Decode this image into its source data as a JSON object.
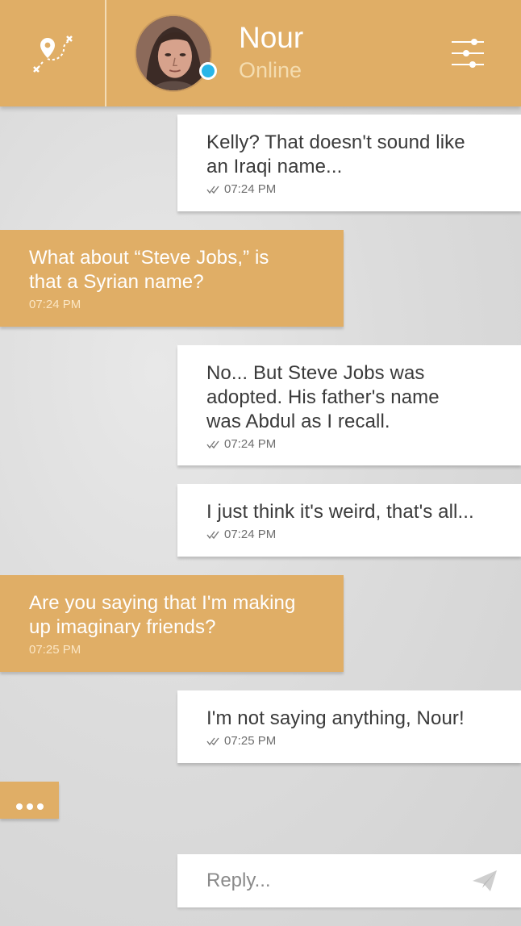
{
  "header": {
    "contact_name": "Nour",
    "contact_status": "Online",
    "status_color": "#29b6e8",
    "accent_color": "#e0ae66"
  },
  "messages": [
    {
      "direction": "outgoing",
      "text": "Kelly? That doesn't sound like\nan Iraqi name...",
      "time": "07:24 PM",
      "read_icon": "double-check-icon"
    },
    {
      "direction": "incoming",
      "text": "What about “Steve Jobs,” is\nthat a Syrian name?",
      "time": "07:24 PM"
    },
    {
      "direction": "outgoing",
      "text": "No... But Steve Jobs was\nadopted. His father's name\nwas Abdul as I recall.",
      "time": "07:24 PM",
      "read_icon": "double-check-icon"
    },
    {
      "direction": "outgoing",
      "text": "I just think it's weird, that's all...",
      "time": "07:24 PM",
      "read_icon": "double-check-icon"
    },
    {
      "direction": "incoming",
      "text": "Are you saying that I'm making\nup imaginary friends?",
      "time": "07:25 PM"
    },
    {
      "direction": "outgoing",
      "text": "I'm not saying anything, Nour!",
      "time": "07:25 PM",
      "read_icon": "double-check-icon"
    }
  ],
  "typing_indicator": {
    "icon": "ellipsis-icon"
  },
  "reply": {
    "placeholder": "Reply...",
    "value": "",
    "send_icon": "paper-plane-icon"
  },
  "icons": {
    "map": "map-route-icon",
    "settings": "sliders-icon"
  }
}
